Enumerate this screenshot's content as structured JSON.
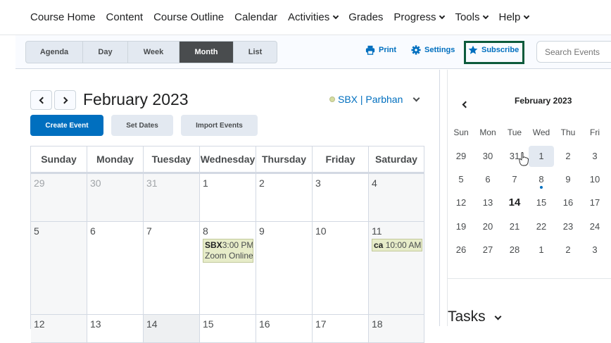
{
  "nav": {
    "items": [
      {
        "label": "Course Home",
        "dropdown": false
      },
      {
        "label": "Content",
        "dropdown": false
      },
      {
        "label": "Course Outline",
        "dropdown": false
      },
      {
        "label": "Calendar",
        "dropdown": false
      },
      {
        "label": "Activities",
        "dropdown": true
      },
      {
        "label": "Grades",
        "dropdown": false
      },
      {
        "label": "Progress",
        "dropdown": true
      },
      {
        "label": "Tools",
        "dropdown": true
      },
      {
        "label": "Help",
        "dropdown": true
      }
    ]
  },
  "toolbar": {
    "views": [
      "Agenda",
      "Day",
      "Week",
      "Month",
      "List"
    ],
    "active_view": "Month",
    "print_label": "Print",
    "settings_label": "Settings",
    "subscribe_label": "Subscribe",
    "search_placeholder": "Search Events"
  },
  "main": {
    "month_title": "February 2023",
    "calendar_name": "SBX | Parbhan",
    "create_event_label": "Create Event",
    "set_dates_label": "Set Dates",
    "import_events_label": "Import Events",
    "weekdays": [
      "Sunday",
      "Monday",
      "Tuesday",
      "Wednesday",
      "Thursday",
      "Friday",
      "Saturday"
    ],
    "weeks": [
      [
        "29",
        "30",
        "31",
        "1",
        "2",
        "3",
        "4"
      ],
      [
        "5",
        "6",
        "7",
        "8",
        "9",
        "10",
        "11"
      ],
      [
        "12",
        "13",
        "14",
        "15",
        "16",
        "17",
        "18"
      ]
    ],
    "events": {
      "wed_8": {
        "prefix": "SBX",
        "time": "3:00 PM",
        "title": "Zoom Online"
      },
      "sat_11": {
        "prefix": "ca",
        "time": "10:00 AM"
      }
    }
  },
  "mini": {
    "title": "February 2023",
    "weekdays": [
      "Sun",
      "Mon",
      "Tue",
      "Wed",
      "Thu",
      "Fri"
    ],
    "weeks": [
      [
        "29",
        "30",
        "31",
        "1",
        "2",
        "3"
      ],
      [
        "5",
        "6",
        "7",
        "8",
        "9",
        "10"
      ],
      [
        "12",
        "13",
        "14",
        "15",
        "16",
        "17"
      ],
      [
        "19",
        "20",
        "21",
        "22",
        "23",
        "24"
      ],
      [
        "26",
        "27",
        "28",
        "1",
        "2",
        "3"
      ]
    ],
    "selected_day": "1",
    "today": "14"
  },
  "tasks": {
    "title": "Tasks"
  },
  "colors": {
    "accent": "#006fbf",
    "active_tab": "#494c4e",
    "event_bg": "#e7ecc9",
    "subscribe_border": "#0d5b3c"
  }
}
